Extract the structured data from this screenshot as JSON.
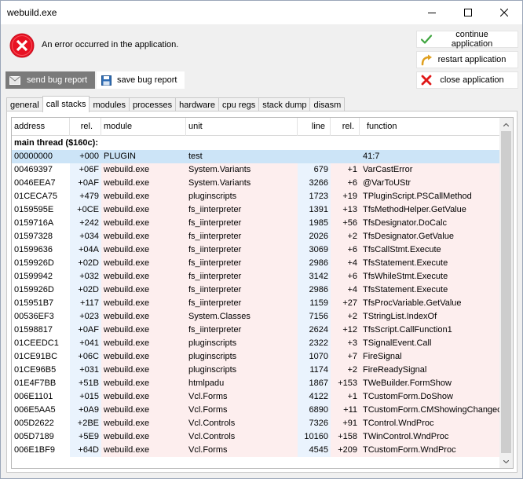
{
  "window": {
    "title": "webuild.exe"
  },
  "error": {
    "message": "An error occurred in the application."
  },
  "actions": {
    "continue_label": "continue application",
    "restart_label": "restart application",
    "close_label": "close application"
  },
  "report": {
    "send_label": "send bug report",
    "save_label": "save bug report"
  },
  "tabs": [
    {
      "label": "general"
    },
    {
      "label": "call stacks",
      "active": true
    },
    {
      "label": "modules"
    },
    {
      "label": "processes"
    },
    {
      "label": "hardware"
    },
    {
      "label": "cpu regs"
    },
    {
      "label": "stack dump"
    },
    {
      "label": "disasm"
    }
  ],
  "columns": {
    "address": "address",
    "rel": "rel.",
    "module": "module",
    "unit": "unit",
    "line": "line",
    "line_rel": "rel.",
    "function": "function"
  },
  "thread": {
    "label": "main thread ($160c):"
  },
  "rows": [
    [
      "00000000",
      "+000",
      "PLUGIN",
      "test",
      "",
      "",
      "41:7"
    ],
    [
      "00469397",
      "+06F",
      "webuild.exe",
      "System.Variants",
      "679",
      "+1",
      "VarCastError"
    ],
    [
      "0046EEA7",
      "+0AF",
      "webuild.exe",
      "System.Variants",
      "3266",
      "+6",
      "@VarToUStr"
    ],
    [
      "01CECA75",
      "+479",
      "webuild.exe",
      "pluginscripts",
      "1723",
      "+19",
      "TPluginScript.PSCallMethod"
    ],
    [
      "0159595E",
      "+0CE",
      "webuild.exe",
      "fs_iinterpreter",
      "1391",
      "+13",
      "TfsMethodHelper.GetValue"
    ],
    [
      "0159716A",
      "+242",
      "webuild.exe",
      "fs_iinterpreter",
      "1985",
      "+56",
      "TfsDesignator.DoCalc"
    ],
    [
      "01597328",
      "+034",
      "webuild.exe",
      "fs_iinterpreter",
      "2026",
      "+2",
      "TfsDesignator.GetValue"
    ],
    [
      "01599636",
      "+04A",
      "webuild.exe",
      "fs_iinterpreter",
      "3069",
      "+6",
      "TfsCallStmt.Execute"
    ],
    [
      "0159926D",
      "+02D",
      "webuild.exe",
      "fs_iinterpreter",
      "2986",
      "+4",
      "TfsStatement.Execute"
    ],
    [
      "01599942",
      "+032",
      "webuild.exe",
      "fs_iinterpreter",
      "3142",
      "+6",
      "TfsWhileStmt.Execute"
    ],
    [
      "0159926D",
      "+02D",
      "webuild.exe",
      "fs_iinterpreter",
      "2986",
      "+4",
      "TfsStatement.Execute"
    ],
    [
      "015951B7",
      "+117",
      "webuild.exe",
      "fs_iinterpreter",
      "1159",
      "+27",
      "TfsProcVariable.GetValue"
    ],
    [
      "00536EF3",
      "+023",
      "webuild.exe",
      "System.Classes",
      "7156",
      "+2",
      "TStringList.IndexOf"
    ],
    [
      "01598817",
      "+0AF",
      "webuild.exe",
      "fs_iinterpreter",
      "2624",
      "+12",
      "TfsScript.CallFunction1"
    ],
    [
      "01CEEDC1",
      "+041",
      "webuild.exe",
      "pluginscripts",
      "2322",
      "+3",
      "TSignalEvent.Call"
    ],
    [
      "01CE91BC",
      "+06C",
      "webuild.exe",
      "pluginscripts",
      "1070",
      "+7",
      "FireSignal"
    ],
    [
      "01CE96B5",
      "+031",
      "webuild.exe",
      "pluginscripts",
      "1174",
      "+2",
      "FireReadySignal"
    ],
    [
      "01E4F7BB",
      "+51B",
      "webuild.exe",
      "htmlpadu",
      "1867",
      "+153",
      "TWeBuilder.FormShow"
    ],
    [
      "006E1101",
      "+015",
      "webuild.exe",
      "Vcl.Forms",
      "4122",
      "+1",
      "TCustomForm.DoShow"
    ],
    [
      "006E5AA5",
      "+0A9",
      "webuild.exe",
      "Vcl.Forms",
      "6890",
      "+11",
      "TCustomForm.CMShowingChanged"
    ],
    [
      "005D2622",
      "+2BE",
      "webuild.exe",
      "Vcl.Controls",
      "7326",
      "+91",
      "TControl.WndProc"
    ],
    [
      "005D7189",
      "+5E9",
      "webuild.exe",
      "Vcl.Controls",
      "10160",
      "+158",
      "TWinControl.WndProc"
    ],
    [
      "006E1BF9",
      "+64D",
      "webuild.exe",
      "Vcl.Forms",
      "4545",
      "+209",
      "TCustomForm.WndProc"
    ]
  ],
  "colors": {
    "title_bg": "#ffffff",
    "send_button_bg": "#7a7a7a",
    "rel_column_bg": "#eaf3fd",
    "text_column_bg": "#fdeeee",
    "selection_bg": "#cce4f7",
    "error_red": "#e81123"
  },
  "icons": {
    "error": "error-circle-icon",
    "continue": "checkmark-icon",
    "restart": "restart-arrow-icon",
    "close": "red-x-icon",
    "send": "envelope-icon",
    "save": "floppy-disk-icon"
  }
}
